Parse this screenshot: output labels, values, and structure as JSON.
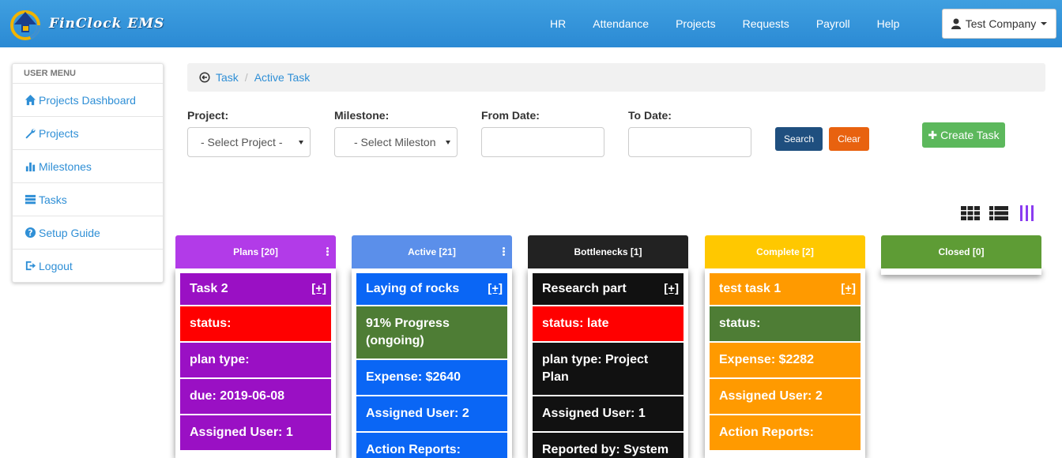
{
  "app": {
    "brand": "FinClock EMS"
  },
  "nav": {
    "items": [
      "HR",
      "Attendance",
      "Projects",
      "Requests",
      "Payroll",
      "Help"
    ],
    "user_label": "Test Company"
  },
  "sidebar": {
    "heading": "USER MENU",
    "items": [
      {
        "label": "Projects Dashboard",
        "icon": "home-icon"
      },
      {
        "label": "Projects",
        "icon": "wrench-icon"
      },
      {
        "label": "Milestones",
        "icon": "bar-chart-icon"
      },
      {
        "label": "Tasks",
        "icon": "tasks-icon"
      },
      {
        "label": "Setup Guide",
        "icon": "question-icon"
      },
      {
        "label": "Logout",
        "icon": "logout-icon"
      }
    ]
  },
  "breadcrumb": {
    "root": "Task",
    "current": "Active Task"
  },
  "filters": {
    "project_label": "Project:",
    "project_value": "- Select Project -",
    "milestone_label": "Milestone:",
    "milestone_value": "- Select Milestone -",
    "from_label": "From Date:",
    "from_value": "",
    "to_label": "To Date:",
    "to_value": "",
    "search_button": "Search",
    "clear_button": "Clear",
    "create_button": "Create Task"
  },
  "colors": {
    "plans": "#b23be8",
    "active": "#5b8fea",
    "bottlenecks": "#222222",
    "complete": "#ffc800",
    "closed": "#5e9c35"
  },
  "columns": [
    {
      "title": "Plans [20]",
      "card": {
        "title": "Task 2",
        "plus": "[+]",
        "rows": [
          "status:",
          "plan type:",
          "due: 2019-06-08",
          "Assigned User: 1"
        ]
      }
    },
    {
      "title": "Active [21]",
      "card": {
        "title": "Laying of rocks",
        "plus": "[+]",
        "rows": [
          "91% Progress (ongoing)",
          "Expense: $2640",
          "Assigned User: 2",
          "Action Reports:"
        ]
      }
    },
    {
      "title": "Bottlenecks [1]",
      "card": {
        "title": "Research part",
        "plus": "[+]",
        "rows": [
          "status: late",
          "plan type: Project Plan",
          "Assigned User: 1",
          "Reported by: System"
        ]
      }
    },
    {
      "title": "Complete [2]",
      "card": {
        "title": "test task 1",
        "plus": "[+]",
        "rows": [
          "status:",
          "Expense: $2282",
          "Assigned User: 2",
          "Action Reports:"
        ]
      }
    },
    {
      "title": "Closed [0]"
    }
  ]
}
